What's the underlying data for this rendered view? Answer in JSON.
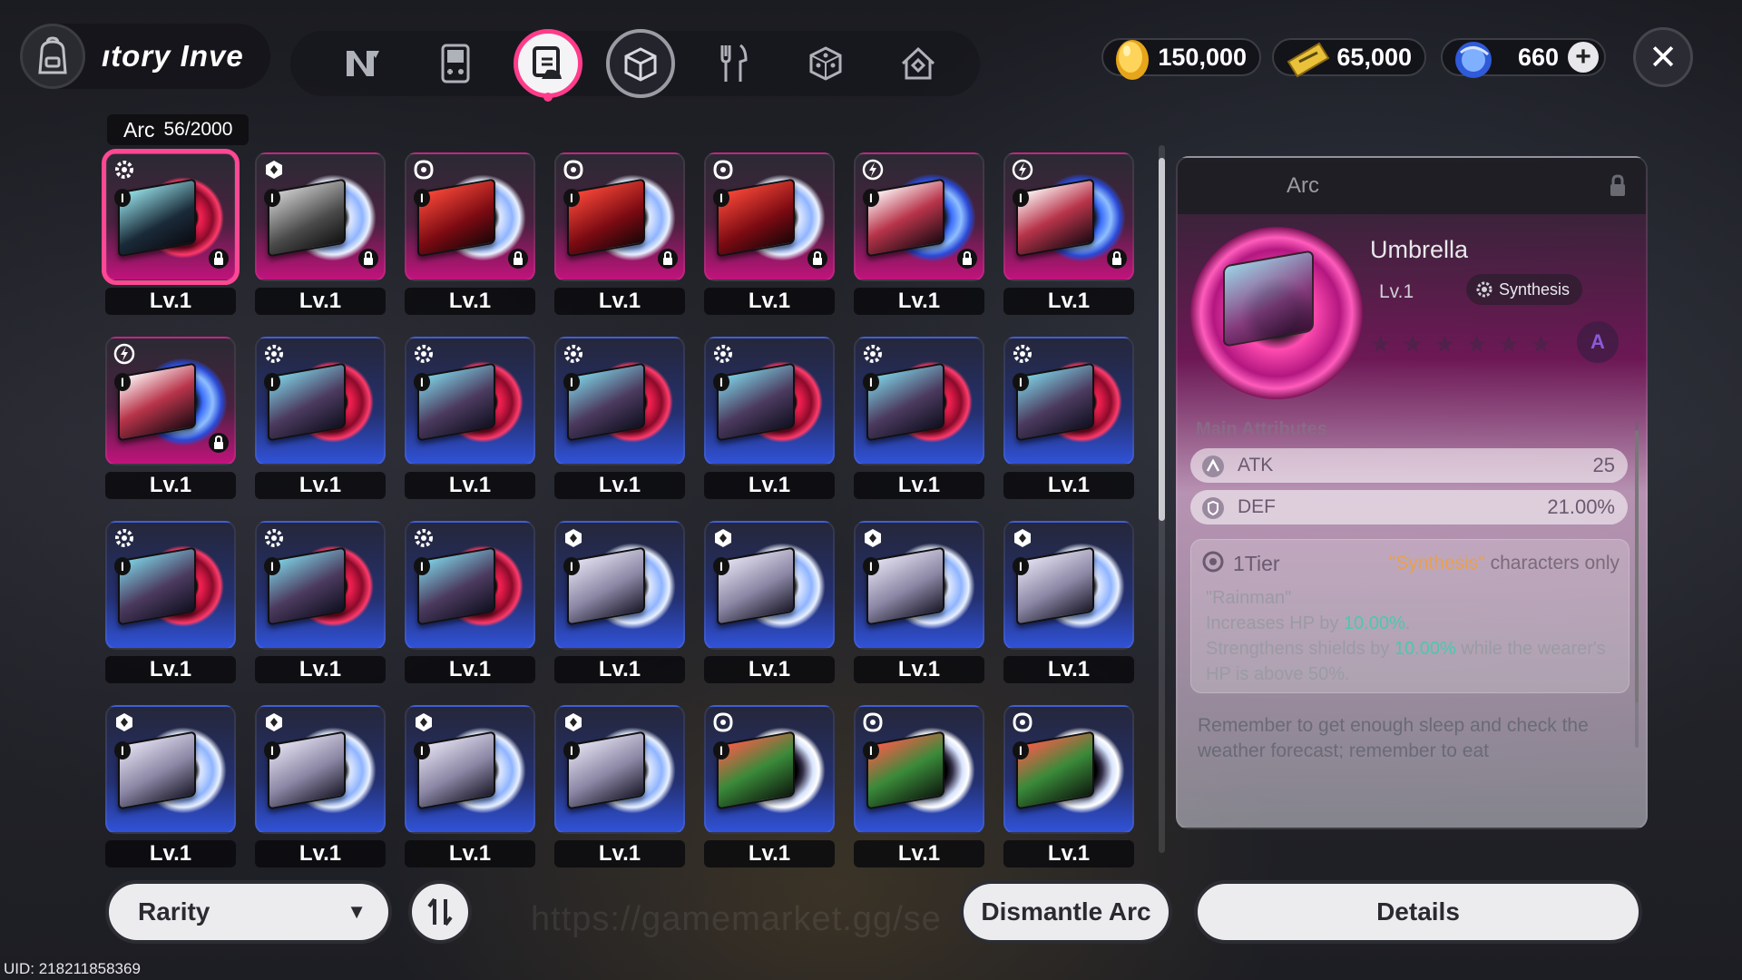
{
  "header": {
    "title": "ıtory Inve",
    "tabs": [
      {
        "icon": "n-logo-icon",
        "active": false
      },
      {
        "icon": "gameboy-icon",
        "active": false
      },
      {
        "icon": "arc-disc-icon",
        "active": true
      },
      {
        "icon": "cube-icon",
        "active": false,
        "framed": true
      },
      {
        "icon": "utensils-icon",
        "active": false
      },
      {
        "icon": "dice-icon",
        "active": false
      },
      {
        "icon": "house-icon",
        "active": false
      }
    ],
    "currencies": {
      "gold": "150,000",
      "ticket": "65,000",
      "crystal": "660"
    }
  },
  "inventory": {
    "category": "Arc",
    "count": "56/2000",
    "items": [
      {
        "lv": "Lv.1",
        "bg": "pink",
        "disc": "red",
        "jacket": "a",
        "type": "gear",
        "locked": true,
        "selected": true
      },
      {
        "lv": "Lv.1",
        "bg": "pink",
        "disc": "white",
        "jacket": "b",
        "type": "hex",
        "locked": true
      },
      {
        "lv": "Lv.1",
        "bg": "pink",
        "disc": "white",
        "jacket": "c",
        "type": "swirl",
        "locked": true
      },
      {
        "lv": "Lv.1",
        "bg": "pink",
        "disc": "white",
        "jacket": "c",
        "type": "swirl",
        "locked": true
      },
      {
        "lv": "Lv.1",
        "bg": "pink",
        "disc": "white",
        "jacket": "c",
        "type": "swirl",
        "locked": true
      },
      {
        "lv": "Lv.1",
        "bg": "pink",
        "disc": "electric",
        "jacket": "d",
        "type": "bolt",
        "locked": true
      },
      {
        "lv": "Lv.1",
        "bg": "pink",
        "disc": "electric",
        "jacket": "d",
        "type": "bolt",
        "locked": true
      },
      {
        "lv": "Lv.1",
        "bg": "pink",
        "disc": "electric",
        "jacket": "d",
        "type": "bolt",
        "locked": true
      },
      {
        "lv": "Lv.1",
        "bg": "blue",
        "disc": "red",
        "jacket": "e",
        "type": "gear"
      },
      {
        "lv": "Lv.1",
        "bg": "blue",
        "disc": "red",
        "jacket": "e",
        "type": "gear"
      },
      {
        "lv": "Lv.1",
        "bg": "blue",
        "disc": "red",
        "jacket": "e",
        "type": "gear"
      },
      {
        "lv": "Lv.1",
        "bg": "blue",
        "disc": "red",
        "jacket": "e",
        "type": "gear"
      },
      {
        "lv": "Lv.1",
        "bg": "blue",
        "disc": "red",
        "jacket": "e",
        "type": "gear"
      },
      {
        "lv": "Lv.1",
        "bg": "blue",
        "disc": "red",
        "jacket": "e",
        "type": "gear"
      },
      {
        "lv": "Lv.1",
        "bg": "blue",
        "disc": "red",
        "jacket": "e",
        "type": "gear"
      },
      {
        "lv": "Lv.1",
        "bg": "blue",
        "disc": "red",
        "jacket": "e",
        "type": "gear"
      },
      {
        "lv": "Lv.1",
        "bg": "blue",
        "disc": "red",
        "jacket": "e",
        "type": "gear"
      },
      {
        "lv": "Lv.1",
        "bg": "blue",
        "disc": "white",
        "jacket": "f",
        "type": "hex"
      },
      {
        "lv": "Lv.1",
        "bg": "blue",
        "disc": "white",
        "jacket": "f",
        "type": "hex"
      },
      {
        "lv": "Lv.1",
        "bg": "blue",
        "disc": "white",
        "jacket": "f",
        "type": "hex"
      },
      {
        "lv": "Lv.1",
        "bg": "blue",
        "disc": "white",
        "jacket": "f",
        "type": "hex"
      },
      {
        "lv": "Lv.1",
        "bg": "blue",
        "disc": "white",
        "jacket": "f",
        "type": "hex"
      },
      {
        "lv": "Lv.1",
        "bg": "blue",
        "disc": "white",
        "jacket": "f",
        "type": "hex"
      },
      {
        "lv": "Lv.1",
        "bg": "blue",
        "disc": "white",
        "jacket": "f",
        "type": "hex"
      },
      {
        "lv": "Lv.1",
        "bg": "blue",
        "disc": "white",
        "jacket": "f",
        "type": "hex"
      },
      {
        "lv": "Lv.1",
        "bg": "blue",
        "disc": "dark",
        "jacket": "g",
        "type": "swirl"
      },
      {
        "lv": "Lv.1",
        "bg": "blue",
        "disc": "dark",
        "jacket": "g",
        "type": "swirl"
      },
      {
        "lv": "Lv.1",
        "bg": "blue",
        "disc": "dark",
        "jacket": "g",
        "type": "swirl"
      }
    ]
  },
  "detail": {
    "category": "Arc",
    "name": "Umbrella",
    "level": "Lv.1",
    "attribute_chip": "Synthesis",
    "stars_total": 6,
    "main_attributes_title": "Main Attributes",
    "attributes": [
      {
        "name": "ATK",
        "value": "25"
      },
      {
        "name": "DEF",
        "value": "21.00%"
      }
    ],
    "tier_label": "1Tier",
    "tier_requirement_highlight": "\"Synthesis\"",
    "tier_requirement_rest": " characters only",
    "effect_name": "\"Rainman\"",
    "effect_line1_a": "Increases HP by ",
    "effect_line1_value": "10.00%",
    "effect_line1_b": ".",
    "effect_line2_a": "Strengthens shields by ",
    "effect_line2_value": "10.00%",
    "effect_line2_b": " while the wearer's HP is above 50%.",
    "flavor_text": "Remember to get enough sleep and check the weather forecast; remember to eat"
  },
  "bottom": {
    "filter_label": "Rarity",
    "watermark": "https://gamemarket.gg/se",
    "dismantle_label": "Dismantle Arc",
    "details_label": "Details",
    "uid": "UID: 218211858369"
  },
  "colors": {
    "accent_pink": "#ff3c8a",
    "highlight_orange": "#e8a050",
    "highlight_teal": "#4ac8b0"
  }
}
